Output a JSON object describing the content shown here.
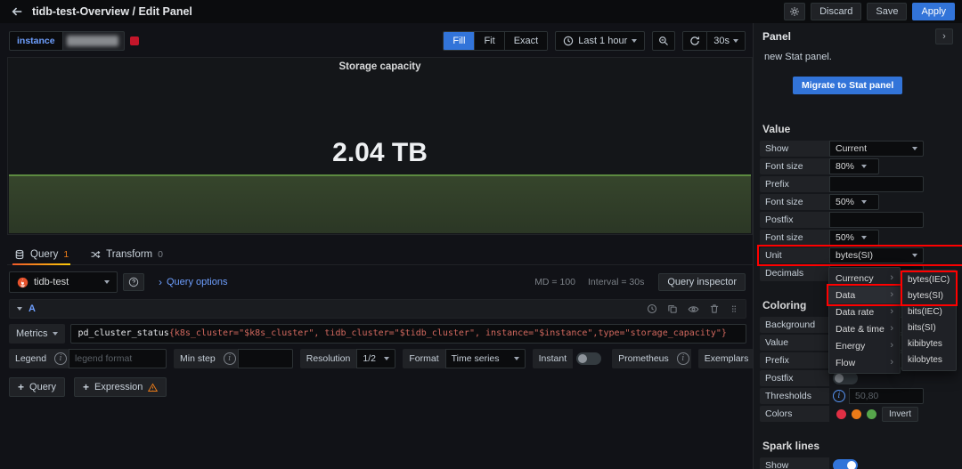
{
  "topbar": {
    "title": "tidb-test-Overview / Edit Panel",
    "discard_label": "Discard",
    "save_label": "Save",
    "apply_label": "Apply"
  },
  "toolbar": {
    "variable_label": "instance",
    "fill_label": "Fill",
    "fit_label": "Fit",
    "exact_label": "Exact",
    "time_range": "Last 1 hour",
    "refresh_interval": "30s"
  },
  "panel": {
    "title": "Storage capacity",
    "value": "2.04 TB"
  },
  "query": {
    "tab_query": "Query",
    "tab_query_count": "1",
    "tab_transform": "Transform",
    "tab_transform_count": "0",
    "datasource": "tidb-test",
    "options_label": "Query options",
    "stat_md": "MD = 100",
    "stat_interval": "Interval = 30s",
    "inspector_label": "Query inspector",
    "row_ref": "A",
    "metrics_label": "Metrics",
    "expr_metric": "pd_cluster_status",
    "expr_selector": "{k8s_cluster=\"$k8s_cluster\", tidb_cluster=\"$tidb_cluster\", instance=\"$instance\",type=\"storage_capacity\"}",
    "legend_label": "Legend",
    "legend_placeholder": "legend format",
    "min_step_label": "Min step",
    "resolution_label": "Resolution",
    "resolution_value": "1/2",
    "format_label": "Format",
    "format_value": "Time series",
    "instant_label": "Instant",
    "prometheus_label": "Prometheus",
    "exemplars_label": "Exemplars",
    "add_query_label": "Query",
    "add_expression_label": "Expression"
  },
  "sidebar": {
    "header": "Panel",
    "note": "new Stat panel.",
    "migrate_label": "Migrate to Stat panel",
    "value_title": "Value",
    "value_rows": [
      {
        "label": "Show",
        "value": "Current"
      },
      {
        "label": "Font size",
        "value": "80%"
      },
      {
        "label": "Prefix",
        "value": ""
      },
      {
        "label": "Font size",
        "value": "50%"
      },
      {
        "label": "Postfix",
        "value": ""
      },
      {
        "label": "Font size",
        "value": "50%"
      },
      {
        "label": "Unit",
        "value": "bytes(SI)"
      },
      {
        "label": "Decimals",
        "value": ""
      }
    ],
    "coloring": {
      "title": "Coloring",
      "background_label": "Background",
      "value_label": "Value",
      "prefix_label": "Prefix",
      "postfix_label": "Postfix",
      "thresholds_label": "Thresholds",
      "thresholds_placeholder": "50,80",
      "colors_label": "Colors",
      "invert_label": "Invert",
      "dot_colors": [
        "#e02f44",
        "#eb7b18",
        "#56a64b"
      ]
    },
    "sparklines_title": "Spark lines",
    "sparklines_show_label": "Show"
  },
  "unit_menu": {
    "items": [
      {
        "label": "Currency"
      },
      {
        "label": "Data"
      },
      {
        "label": "Data rate"
      },
      {
        "label": "Date & time"
      },
      {
        "label": "Energy"
      },
      {
        "label": "Flow"
      }
    ],
    "submenu": [
      "bytes(IEC)",
      "bytes(SI)",
      "bits(IEC)",
      "bits(SI)",
      "kibibytes",
      "kilobytes"
    ]
  },
  "colors": {
    "accent_blue": "#3274d9",
    "annotation_red": "#ff0000",
    "prometheus_orange": "#e6522c",
    "graph_green": "#5c8a40"
  }
}
